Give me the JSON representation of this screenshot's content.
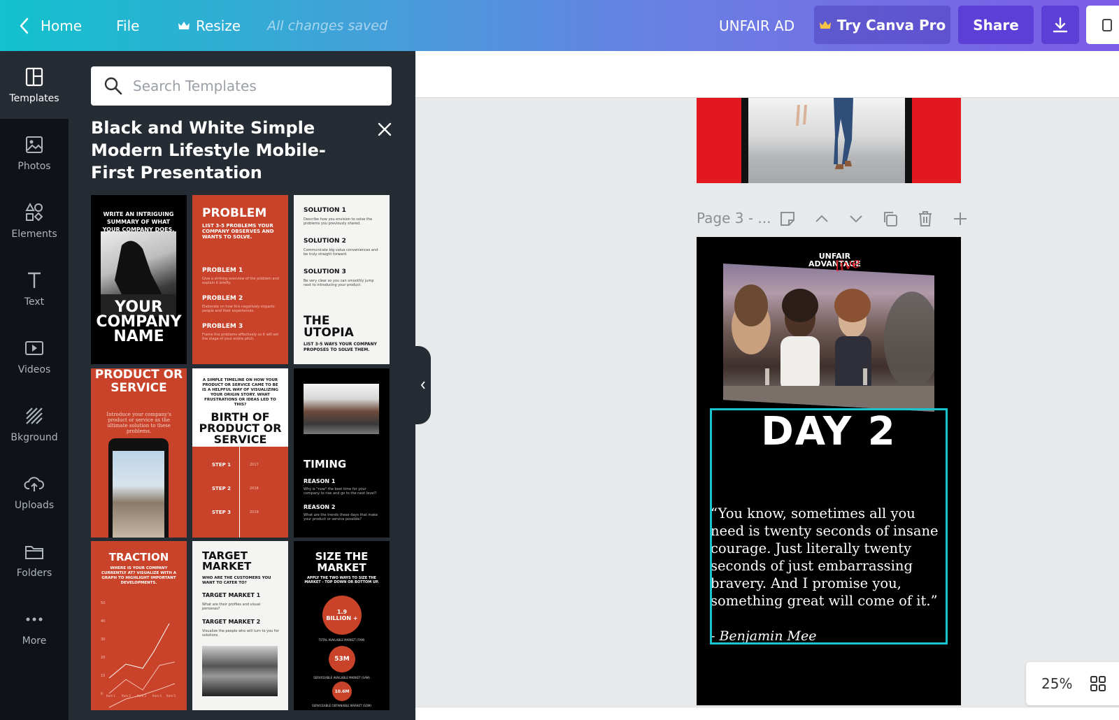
{
  "topbar": {
    "home": "Home",
    "file": "File",
    "resize": "Resize",
    "saved": "All changes saved",
    "doc_title": "UNFAIR AD",
    "try_pro": "Try Canva Pro",
    "share": "Share"
  },
  "rail": {
    "items": [
      {
        "label": "Templates",
        "icon": "templates-icon"
      },
      {
        "label": "Photos",
        "icon": "photos-icon"
      },
      {
        "label": "Elements",
        "icon": "elements-icon"
      },
      {
        "label": "Text",
        "icon": "text-icon"
      },
      {
        "label": "Videos",
        "icon": "videos-icon"
      },
      {
        "label": "Bkground",
        "icon": "background-icon"
      },
      {
        "label": "Uploads",
        "icon": "uploads-icon"
      },
      {
        "label": "Folders",
        "icon": "folders-icon"
      },
      {
        "label": "More",
        "icon": "more-icon"
      }
    ]
  },
  "panel": {
    "search_placeholder": "Search Templates",
    "title": "Black and White Simple Modern Lifestyle Mobile-First Presentation",
    "thumbs": {
      "t1": {
        "top": "WRITE AN INTRIGUING SUMMARY OF WHAT YOUR COMPANY DOES.",
        "big": "YOUR COMPANY NAME"
      },
      "t2": {
        "h": "PROBLEM",
        "sub": "LIST 3-5 PROBLEMS YOUR COMPANY OBSERVES AND WANTS TO SOLVE.",
        "p1": "PROBLEM 1",
        "p1d": "Give a striking overview of the problem and explain it briefly.",
        "p2": "PROBLEM 2",
        "p2d": "Elaborate on how this negatively impacts people and their experiences.",
        "p3": "PROBLEM 3",
        "p3d": "Frame the problems effectively so it will set the stage of your entire pitch."
      },
      "t3": {
        "s1": "SOLUTION 1",
        "s1d": "Describe how you envision to solve the problems you previously shared.",
        "s2": "SOLUTION 2",
        "s2d": "Communicate big value conveniences and be truly straight forward.",
        "s3": "SOLUTION 3",
        "s3d": "Be very clear so you can smoothly jump next to introducing your product.",
        "big": "THE UTOPIA",
        "sub": "LIST 3-5 WAYS YOUR COMPANY PROPOSES TO SOLVE THEM."
      },
      "t4": {
        "h": "PRODUCT OR SERVICE",
        "sub": "Introduce your company's product or service as the ultimate solution to these problems."
      },
      "t5": {
        "top": "A SIMPLE TIMELINE ON HOW YOUR PRODUCT OR SERVICE CAME TO BE IS A HELPFUL WAY OF VISUALIZING YOUR ORIGIN STORY. WHAT FRUSTRATIONS OR IDEAS LED TO THIS?",
        "h": "BIRTH OF PRODUCT OR SERVICE",
        "s1": "STEP 1",
        "y1": "2017",
        "s2": "STEP 2",
        "y2": "2018",
        "s3": "STEP 3",
        "y3": "2019"
      },
      "t6": {
        "h": "TIMING",
        "r1": "REASON 1",
        "r1d": "Why is \"now\" the best time for your company to rise and go to the next level?",
        "r2": "REASON 2",
        "r2d": "What are the trends these days that make your product or service possible?"
      },
      "t7": {
        "h": "TRACTION",
        "sub": "WHERE IS YOUR COMPANY CURRENTLY AT? VISUALIZE WITH A GRAPH TO HIGHLIGHT IMPORTANT DEVELOPMENTS.",
        "yticks": [
          "50",
          "40",
          "30",
          "20",
          "10",
          "0"
        ],
        "xticks": [
          "Item 1",
          "Item 2",
          "Item 3",
          "Item 4",
          "Item 5"
        ]
      },
      "t8": {
        "h": "TARGET MARKET",
        "sub": "WHO ARE THE CUSTOMERS YOU WANT TO CATER TO?",
        "m1": "TARGET MARKET 1",
        "m1d": "What are their profiles and visual personas?",
        "m2": "TARGET MARKET 2",
        "m2d": "Visualize the people who will turn to you for solutions."
      },
      "t9": {
        "h": "SIZE THE MARKET",
        "sub": "APPLY THE TWO WAYS TO SIZE THE MARKET - TOP DOWN OR BOTTOM UP.",
        "c1": "1.9 BILLION +",
        "c1l": "TOTAL AVAILABLE MARKET (TAM)",
        "c2": "53M",
        "c2l": "SERVICEABLE AVAILABLE MARKET (SAM)",
        "c3": "10.6M",
        "c3l": "SERVICEABLE OBTAINABLE MARKET (SOM)"
      }
    }
  },
  "canvas": {
    "page_label": "Page 3 - ...",
    "logo_line1": "UNFAIR",
    "logo_line2": "ADVANTAGE",
    "logo_script": "live",
    "day_title": "DAY 2",
    "quote": "“You know, sometimes all you need is twenty seconds of insane courage. Just literally twenty seconds of just embarrassing bravery. And I promise you, something great will come of it.”",
    "author": "- Benjamin Mee",
    "zoom": "25%"
  },
  "colors": {
    "accent_cyan": "#1bc3d1",
    "panel_bg": "#262c33",
    "rail_bg": "#0f1317",
    "template_red": "#c8432a",
    "page_red": "#e3171f"
  }
}
